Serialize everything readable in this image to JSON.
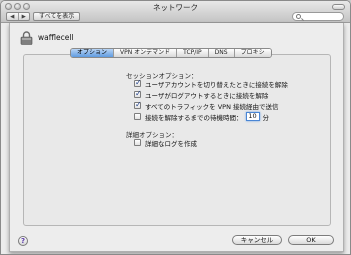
{
  "window": {
    "title": "ネットワーク"
  },
  "toolbar": {
    "back_glyph": "◀",
    "forward_glyph": "▶",
    "show_all_label": "すべてを表示",
    "search_placeholder": ""
  },
  "sheet": {
    "interface_name": "wafflecell",
    "tabs": [
      {
        "label": "オプション",
        "active": true
      },
      {
        "label": "VPN オンデマンド",
        "active": false
      },
      {
        "label": "TCP/IP",
        "active": false
      },
      {
        "label": "DNS",
        "active": false
      },
      {
        "label": "プロキシ",
        "active": false
      }
    ],
    "session_options": {
      "heading": "セッションオプション：",
      "items": [
        {
          "label": "ユーザアカウントを切り替えたときに接続を解除",
          "checked": true
        },
        {
          "label": "ユーザがログアウトするときに接続を解除",
          "checked": true
        },
        {
          "label": "すべてのトラフィックを VPN 接続経由で送信",
          "checked": true
        }
      ],
      "idle": {
        "label": "接続を解除するまでの待機時間：",
        "checked": false,
        "value": "10",
        "unit": "分"
      }
    },
    "advanced_options": {
      "heading": "詳細オプション：",
      "items": [
        {
          "label": "詳細なログを作成",
          "checked": false
        }
      ]
    },
    "buttons": {
      "help": "?",
      "cancel": "キャンセル",
      "ok": "OK"
    }
  }
}
